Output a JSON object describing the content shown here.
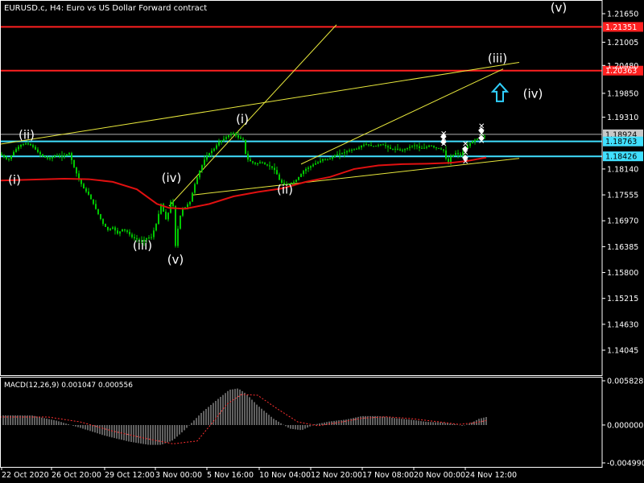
{
  "header": {
    "title": "EURUSD.c, H4:  Euro vs US Dollar Forward contract"
  },
  "colors": {
    "background": "#000000",
    "candle": "#00c800",
    "ma": "#e01010",
    "resistance": "#ff2020",
    "support": "#40e0ff",
    "trend": "#e8e83c",
    "macd_hist": "#c0c0c0",
    "macd_signal": "#ff3030",
    "arrow": "#30d0ff"
  },
  "chart_data": [
    {
      "type": "candlestick",
      "title": "EURUSD.c, H4:  Euro vs US Dollar Forward contract",
      "ylim": [
        1.13645,
        1.2184
      ],
      "y_ticks": [
        "1.21650",
        "1.21005",
        "1.20480",
        "1.19850",
        "1.19310",
        "1.18924",
        "1.18763",
        "1.18426",
        "1.18140",
        "1.17555",
        "1.16970",
        "1.16385",
        "1.15800",
        "1.15215",
        "1.14630",
        "1.14045"
      ],
      "x_labels": [
        "22 Oct 2020",
        "26 Oct 20:00",
        "29 Oct 12:00",
        "3 Nov 00:00",
        "5 Nov 16:00",
        "10 Nov 04:00",
        "12 Nov 20:00",
        "17 Nov 08:00",
        "20 Nov 00:00",
        "24 Nov 12:00"
      ],
      "close_path": [
        [
          0,
          1.1848
        ],
        [
          10,
          1.1834
        ],
        [
          18,
          1.1855
        ],
        [
          25,
          1.1868
        ],
        [
          33,
          1.1872
        ],
        [
          40,
          1.1866
        ],
        [
          48,
          1.185
        ],
        [
          55,
          1.184
        ],
        [
          62,
          1.1838
        ],
        [
          70,
          1.1845
        ],
        [
          78,
          1.1842
        ],
        [
          86,
          1.185
        ],
        [
          92,
          1.1818
        ],
        [
          98,
          1.179
        ],
        [
          104,
          1.177
        ],
        [
          110,
          1.1756
        ],
        [
          116,
          1.1735
        ],
        [
          122,
          1.1712
        ],
        [
          128,
          1.169
        ],
        [
          134,
          1.1676
        ],
        [
          140,
          1.1682
        ],
        [
          146,
          1.1668
        ],
        [
          152,
          1.1678
        ],
        [
          158,
          1.1672
        ],
        [
          164,
          1.166
        ],
        [
          170,
          1.1655
        ],
        [
          176,
          1.165
        ],
        [
          182,
          1.1658
        ],
        [
          188,
          1.166
        ],
        [
          194,
          1.169
        ],
        [
          200,
          1.1735
        ],
        [
          206,
          1.17
        ],
        [
          210,
          1.172
        ],
        [
          214,
          1.176
        ],
        [
          218,
          1.164
        ],
        [
          222,
          1.1692
        ],
        [
          226,
          1.1725
        ],
        [
          230,
          1.1728
        ],
        [
          236,
          1.174
        ],
        [
          242,
          1.178
        ],
        [
          248,
          1.181
        ],
        [
          254,
          1.1835
        ],
        [
          260,
          1.185
        ],
        [
          266,
          1.186
        ],
        [
          272,
          1.1875
        ],
        [
          278,
          1.1882
        ],
        [
          284,
          1.189
        ],
        [
          290,
          1.1895
        ],
        [
          296,
          1.1885
        ],
        [
          302,
          1.188
        ],
        [
          306,
          1.1838
        ],
        [
          312,
          1.183
        ],
        [
          318,
          1.1825
        ],
        [
          324,
          1.183
        ],
        [
          330,
          1.1823
        ],
        [
          336,
          1.182
        ],
        [
          342,
          1.181
        ],
        [
          348,
          1.1785
        ],
        [
          354,
          1.1778
        ],
        [
          360,
          1.1782
        ],
        [
          366,
          1.1785
        ],
        [
          372,
          1.1798
        ],
        [
          378,
          1.1812
        ],
        [
          384,
          1.1818
        ],
        [
          390,
          1.1825
        ],
        [
          396,
          1.183
        ],
        [
          402,
          1.1838
        ],
        [
          408,
          1.1835
        ],
        [
          414,
          1.1842
        ],
        [
          420,
          1.1848
        ],
        [
          426,
          1.185
        ],
        [
          432,
          1.1855
        ],
        [
          438,
          1.1858
        ],
        [
          444,
          1.186
        ],
        [
          450,
          1.1868
        ],
        [
          456,
          1.187
        ],
        [
          462,
          1.1865
        ],
        [
          468,
          1.1867
        ],
        [
          474,
          1.187
        ],
        [
          480,
          1.1865
        ],
        [
          486,
          1.1858
        ],
        [
          492,
          1.186
        ],
        [
          498,
          1.1855
        ],
        [
          504,
          1.186
        ],
        [
          510,
          1.1865
        ],
        [
          516,
          1.1868
        ],
        [
          522,
          1.186
        ],
        [
          528,
          1.1862
        ],
        [
          534,
          1.1868
        ],
        [
          540,
          1.1862
        ],
        [
          546,
          1.186
        ],
        [
          552,
          1.1855
        ],
        [
          556,
          1.182
        ],
        [
          560,
          1.1842
        ],
        [
          566,
          1.185
        ],
        [
          572,
          1.1845
        ],
        [
          578,
          1.186
        ],
        [
          584,
          1.1872
        ],
        [
          590,
          1.188
        ],
        [
          596,
          1.1885
        ],
        [
          602,
          1.1888
        ]
      ],
      "ma_path": [
        [
          0,
          1.1788
        ],
        [
          40,
          1.179
        ],
        [
          80,
          1.1792
        ],
        [
          110,
          1.1791
        ],
        [
          140,
          1.1785
        ],
        [
          170,
          1.1768
        ],
        [
          195,
          1.1735
        ],
        [
          210,
          1.1726
        ],
        [
          230,
          1.1724
        ],
        [
          260,
          1.1735
        ],
        [
          290,
          1.1752
        ],
        [
          320,
          1.1762
        ],
        [
          350,
          1.177
        ],
        [
          380,
          1.1785
        ],
        [
          410,
          1.1796
        ],
        [
          440,
          1.1814
        ],
        [
          470,
          1.1822
        ],
        [
          500,
          1.1825
        ],
        [
          530,
          1.1826
        ],
        [
          560,
          1.1828
        ],
        [
          580,
          1.1832
        ],
        [
          604,
          1.184
        ]
      ],
      "horizontal_lines": [
        {
          "label": "1.21351",
          "price": 1.21351,
          "kind": "resistance"
        },
        {
          "label": "1.20363",
          "price": 1.20363,
          "kind": "resistance"
        },
        {
          "label": "1.18924",
          "price": 1.18924,
          "kind": "gray"
        },
        {
          "label": "1.18763",
          "price": 1.18763,
          "kind": "support"
        },
        {
          "label": "1.18426",
          "price": 1.18426,
          "kind": "support"
        }
      ],
      "trend_lines": [
        [
          [
            0,
            1.187
          ],
          [
            645,
            1.2055
          ]
        ],
        [
          [
            210,
            1.173
          ],
          [
            418,
            1.214
          ]
        ],
        [
          [
            238,
            1.1755
          ],
          [
            645,
            1.1838
          ]
        ],
        [
          [
            374,
            1.1825
          ],
          [
            625,
            1.204
          ]
        ]
      ],
      "wave_labels": [
        {
          "text": "(i)",
          "at": [
            18,
            1.178
          ]
        },
        {
          "text": "(ii)",
          "at": [
            33,
            1.1882
          ]
        },
        {
          "text": "(iii)",
          "at": [
            177,
            1.1632
          ]
        },
        {
          "text": "(iv)",
          "at": [
            213,
            1.1785
          ]
        },
        {
          "text": "(v)",
          "at": [
            218,
            1.16
          ]
        },
        {
          "text": "(i)",
          "at": [
            301,
            1.1918
          ]
        },
        {
          "text": "(ii)",
          "at": [
            354,
            1.1758
          ]
        },
        {
          "text": "(iii)",
          "at": [
            618,
            1.2055
          ]
        },
        {
          "text": "(iv)",
          "at": [
            662,
            1.1975
          ]
        },
        {
          "text": "(v)",
          "at": [
            694,
            1.217
          ]
        }
      ],
      "signal_arrows": [
        {
          "x": 551,
          "low": 1.1872,
          "high": 1.1895
        },
        {
          "x": 578,
          "low": 1.1832,
          "high": 1.1872
        },
        {
          "x": 598,
          "low": 1.1878,
          "high": 1.1912
        }
      ],
      "up_arrow": {
        "x": 621,
        "price": 1.1985
      }
    },
    {
      "type": "bar",
      "title": "MACD(12,26,9) 0.001047 0.000556",
      "ylim": [
        -0.00499,
        0.005828
      ],
      "y_ticks": [
        "0.005828",
        "0.000000",
        "-0.004990"
      ],
      "histogram_path": [
        [
          0,
          0.00128
        ],
        [
          40,
          0.00125
        ],
        [
          70,
          0.00058
        ],
        [
          100,
          -0.00038
        ],
        [
          130,
          -0.0014
        ],
        [
          160,
          -0.00218
        ],
        [
          185,
          -0.00262
        ],
        [
          200,
          -0.00262
        ],
        [
          215,
          -0.002
        ],
        [
          230,
          -0.0006
        ],
        [
          250,
          0.00158
        ],
        [
          270,
          0.00336
        ],
        [
          285,
          0.00464
        ],
        [
          296,
          0.00482
        ],
        [
          306,
          0.0041
        ],
        [
          320,
          0.00258
        ],
        [
          340,
          0.00082
        ],
        [
          360,
          -0.00048
        ],
        [
          375,
          -0.00068
        ],
        [
          390,
          5e-05
        ],
        [
          410,
          0.00048
        ],
        [
          430,
          0.00072
        ],
        [
          450,
          0.00118
        ],
        [
          470,
          0.00118
        ],
        [
          490,
          0.00092
        ],
        [
          510,
          0.0007
        ],
        [
          530,
          0.00042
        ],
        [
          550,
          0.00032
        ],
        [
          565,
          0.0001
        ],
        [
          575,
          -0.00012
        ],
        [
          585,
          0.00025
        ],
        [
          595,
          0.00082
        ],
        [
          604,
          0.00105
        ]
      ],
      "signal_path": [
        [
          0,
          0.00105
        ],
        [
          60,
          0.00105
        ],
        [
          100,
          0.0004
        ],
        [
          140,
          -0.0008
        ],
        [
          180,
          -0.00175
        ],
        [
          215,
          -0.00248
        ],
        [
          245,
          -0.0021
        ],
        [
          265,
          0.00045
        ],
        [
          282,
          0.00275
        ],
        [
          300,
          0.00402
        ],
        [
          320,
          0.00392
        ],
        [
          345,
          0.0021
        ],
        [
          370,
          0.0004
        ],
        [
          395,
          -0.0001
        ],
        [
          420,
          0.00032
        ],
        [
          450,
          0.0009
        ],
        [
          480,
          0.00108
        ],
        [
          510,
          0.00085
        ],
        [
          540,
          0.00048
        ],
        [
          570,
          8e-05
        ],
        [
          590,
          0.0003
        ],
        [
          604,
          0.00058
        ]
      ]
    }
  ]
}
